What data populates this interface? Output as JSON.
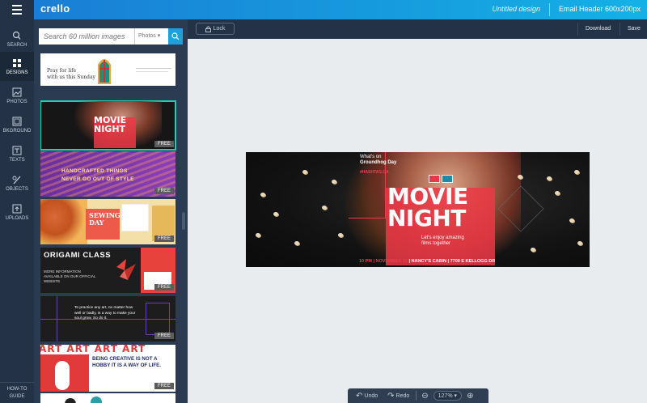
{
  "topbar": {
    "logo": "crello",
    "design_name": "Untitled design",
    "design_size": "Email Header 600x200px",
    "accent_color": "#1a7bd3"
  },
  "sidebar": {
    "items": [
      {
        "label": "SEARCH",
        "icon": "search-icon"
      },
      {
        "label": "DESIGNS",
        "icon": "designs-icon"
      },
      {
        "label": "PHOTOS",
        "icon": "photos-icon"
      },
      {
        "label": "BKGROUND",
        "icon": "background-icon"
      },
      {
        "label": "TEXTS",
        "icon": "texts-icon"
      },
      {
        "label": "OBJECTS",
        "icon": "objects-icon"
      },
      {
        "label": "UPLOADS",
        "icon": "uploads-icon"
      }
    ],
    "howto_line1": "HOW-TO",
    "howto_line2": "GUIDE"
  },
  "search": {
    "placeholder": "Search 60 million images",
    "filter": "Photos"
  },
  "templates": [
    {
      "name": "pray-for-life",
      "text1": "Pray for life",
      "text2": "with us this Sunday",
      "free": ""
    },
    {
      "name": "movie-night",
      "text1": "MOVIE",
      "text2": "NIGHT",
      "free": "FREE"
    },
    {
      "name": "handcrafted-things",
      "text1": "HANDCRAFTED THINGS",
      "text2": "NEVER GO OUT OF STYLE",
      "free": "FREE"
    },
    {
      "name": "sewing-day",
      "text1": "SEWING",
      "text2": "DAY",
      "free": "FREE"
    },
    {
      "name": "origami-class",
      "text1": "ORIGAMI CLASS",
      "text2": "MORE INFORMATION AVAILABLE ON OUR OFFICIAL WEBSITE",
      "free": "FREE"
    },
    {
      "name": "practice-art",
      "text1": "To practice any art, no matter how well or badly, is a way to make your soul grow. So do it.",
      "text2": "",
      "free": "FREE"
    },
    {
      "name": "creative-art",
      "text1": "ART ART ART ART",
      "text2": "BEING CREATIVE IS NOT A HOBBY IT IS A WAY OF LIFE.",
      "free": "FREE"
    }
  ],
  "canvas_bar": {
    "lock": "Lock",
    "download": "Download",
    "save": "Save"
  },
  "design": {
    "whats_on": "What's on",
    "groundhog": "Groundhog Day",
    "hashtag": "#HASHTAG.CA",
    "title_line1": "MOVIE",
    "title_line2": "NIGHT",
    "tagline_line1": "Let's enjoy amazing",
    "tagline_line2": "films together",
    "footer_date": "10 PM | NOVEMBER 31",
    "footer_place": " | NANCY'S CABIN | 7700 E KELLOGG DR"
  },
  "bottom_bar": {
    "undo": "Undo",
    "redo": "Redo",
    "zoom": "127%"
  }
}
